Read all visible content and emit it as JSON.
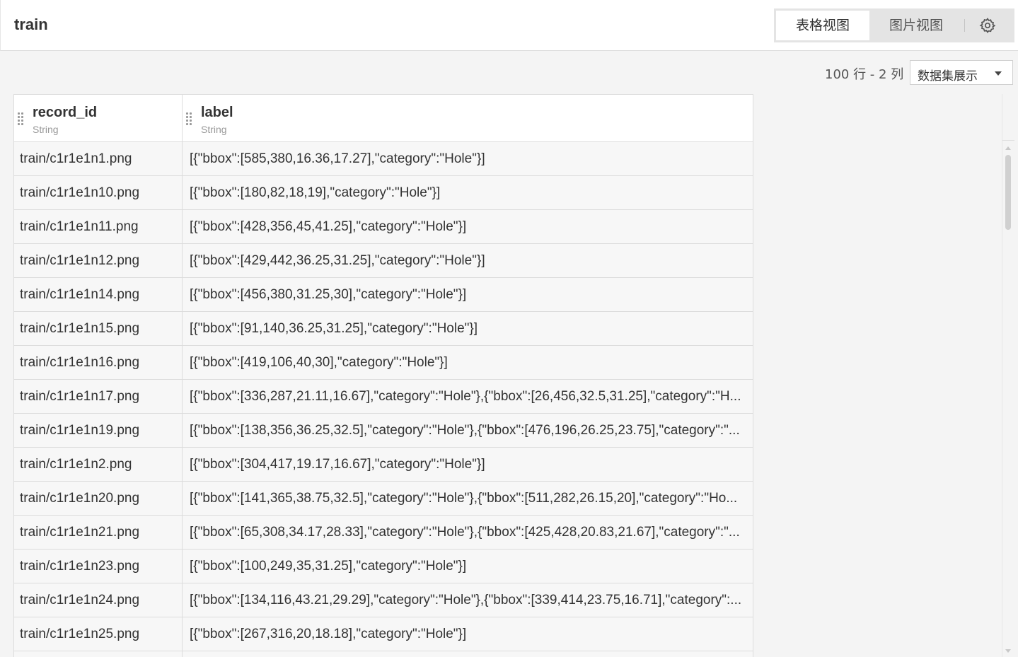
{
  "header": {
    "title": "train",
    "views": [
      {
        "label": "表格视图",
        "active": true
      },
      {
        "label": "图片视图",
        "active": false
      }
    ],
    "settings_icon": "gear-icon"
  },
  "toolbar": {
    "summary": "100 行 - 2 列",
    "display_select": "数据集展示"
  },
  "table": {
    "columns": [
      {
        "name": "record_id",
        "type": "String"
      },
      {
        "name": "label",
        "type": "String"
      }
    ],
    "rows": [
      {
        "record_id": "train/c1r1e1n1.png",
        "label": "[{\"bbox\":[585,380,16.36,17.27],\"category\":\"Hole\"}]"
      },
      {
        "record_id": "train/c1r1e1n10.png",
        "label": "[{\"bbox\":[180,82,18,19],\"category\":\"Hole\"}]"
      },
      {
        "record_id": "train/c1r1e1n11.png",
        "label": "[{\"bbox\":[428,356,45,41.25],\"category\":\"Hole\"}]"
      },
      {
        "record_id": "train/c1r1e1n12.png",
        "label": "[{\"bbox\":[429,442,36.25,31.25],\"category\":\"Hole\"}]"
      },
      {
        "record_id": "train/c1r1e1n14.png",
        "label": "[{\"bbox\":[456,380,31.25,30],\"category\":\"Hole\"}]"
      },
      {
        "record_id": "train/c1r1e1n15.png",
        "label": "[{\"bbox\":[91,140,36.25,31.25],\"category\":\"Hole\"}]"
      },
      {
        "record_id": "train/c1r1e1n16.png",
        "label": "[{\"bbox\":[419,106,40,30],\"category\":\"Hole\"}]"
      },
      {
        "record_id": "train/c1r1e1n17.png",
        "label": "[{\"bbox\":[336,287,21.11,16.67],\"category\":\"Hole\"},{\"bbox\":[26,456,32.5,31.25],\"category\":\"H..."
      },
      {
        "record_id": "train/c1r1e1n19.png",
        "label": "[{\"bbox\":[138,356,36.25,32.5],\"category\":\"Hole\"},{\"bbox\":[476,196,26.25,23.75],\"category\":\"..."
      },
      {
        "record_id": "train/c1r1e1n2.png",
        "label": "[{\"bbox\":[304,417,19.17,16.67],\"category\":\"Hole\"}]"
      },
      {
        "record_id": "train/c1r1e1n20.png",
        "label": "[{\"bbox\":[141,365,38.75,32.5],\"category\":\"Hole\"},{\"bbox\":[511,282,26.15,20],\"category\":\"Ho..."
      },
      {
        "record_id": "train/c1r1e1n21.png",
        "label": "[{\"bbox\":[65,308,34.17,28.33],\"category\":\"Hole\"},{\"bbox\":[425,428,20.83,21.67],\"category\":\"..."
      },
      {
        "record_id": "train/c1r1e1n23.png",
        "label": "[{\"bbox\":[100,249,35,31.25],\"category\":\"Hole\"}]"
      },
      {
        "record_id": "train/c1r1e1n24.png",
        "label": "[{\"bbox\":[134,116,43.21,29.29],\"category\":\"Hole\"},{\"bbox\":[339,414,23.75,16.71],\"category\":..."
      },
      {
        "record_id": "train/c1r1e1n25.png",
        "label": "[{\"bbox\":[267,316,20,18.18],\"category\":\"Hole\"}]"
      },
      {
        "record_id": "",
        "label": ""
      }
    ]
  }
}
